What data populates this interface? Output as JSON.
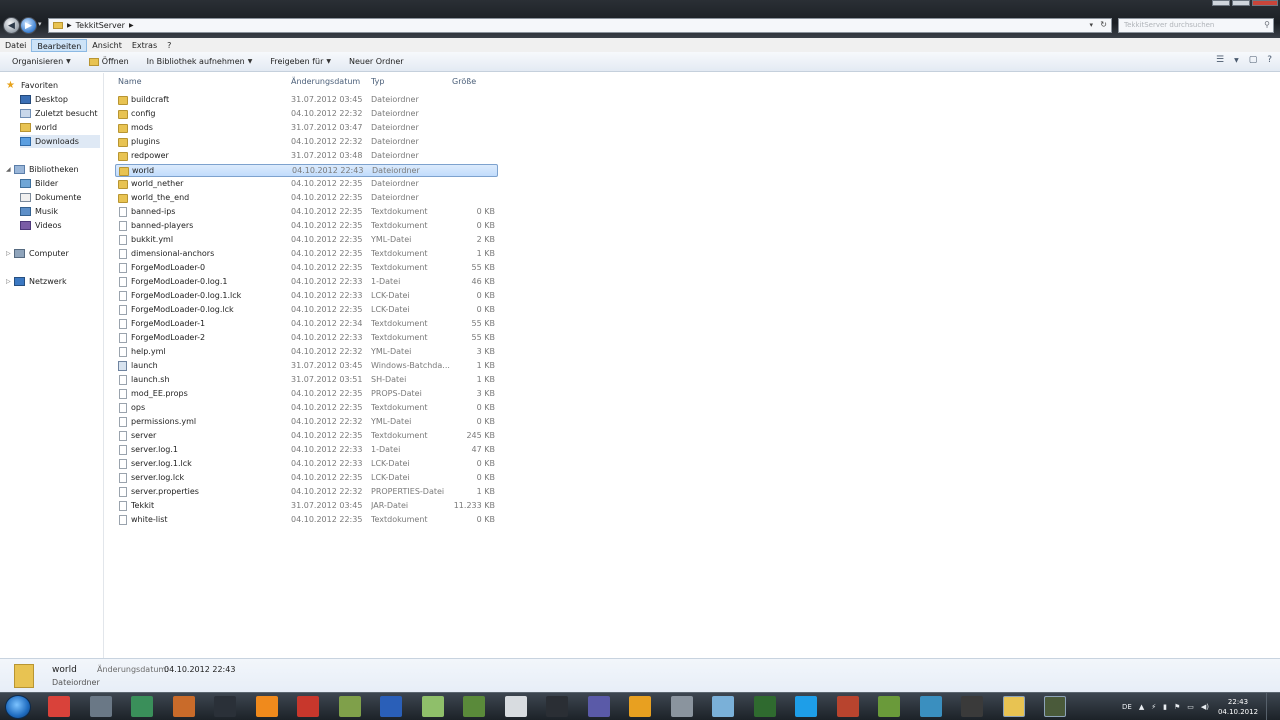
{
  "window": {
    "address_path": "TekkitServer",
    "search_placeholder": "TekkitServer durchsuchen"
  },
  "menu": [
    "Datei",
    "Bearbeiten",
    "Ansicht",
    "Extras",
    "?"
  ],
  "toolbar": {
    "organize": "Organisieren",
    "open": "Öffnen",
    "add_to_library": "In Bibliothek aufnehmen",
    "share": "Freigeben für",
    "new_folder": "Neuer Ordner"
  },
  "nav": {
    "favorites": "Favoriten",
    "desktop": "Desktop",
    "recent": "Zuletzt besucht",
    "world": "world",
    "downloads": "Downloads",
    "libraries": "Bibliotheken",
    "pictures": "Bilder",
    "documents": "Dokumente",
    "music": "Musik",
    "videos": "Videos",
    "computer": "Computer",
    "network": "Netzwerk"
  },
  "columns": {
    "name": "Name",
    "date": "Änderungsdatum",
    "type": "Typ",
    "size": "Größe"
  },
  "files": [
    {
      "name": "buildcraft",
      "date": "31.07.2012 03:45",
      "type": "Dateiordner",
      "size": "",
      "icon": "folder"
    },
    {
      "name": "config",
      "date": "04.10.2012 22:32",
      "type": "Dateiordner",
      "size": "",
      "icon": "folder"
    },
    {
      "name": "mods",
      "date": "31.07.2012 03:47",
      "type": "Dateiordner",
      "size": "",
      "icon": "folder"
    },
    {
      "name": "plugins",
      "date": "04.10.2012 22:32",
      "type": "Dateiordner",
      "size": "",
      "icon": "folder"
    },
    {
      "name": "redpower",
      "date": "31.07.2012 03:48",
      "type": "Dateiordner",
      "size": "",
      "icon": "folder"
    },
    {
      "name": "world",
      "date": "04.10.2012 22:43",
      "type": "Dateiordner",
      "size": "",
      "icon": "folder",
      "selected": true
    },
    {
      "name": "world_nether",
      "date": "04.10.2012 22:35",
      "type": "Dateiordner",
      "size": "",
      "icon": "folder"
    },
    {
      "name": "world_the_end",
      "date": "04.10.2012 22:35",
      "type": "Dateiordner",
      "size": "",
      "icon": "folder"
    },
    {
      "name": "banned-ips",
      "date": "04.10.2012 22:35",
      "type": "Textdokument",
      "size": "0 KB",
      "icon": "doc"
    },
    {
      "name": "banned-players",
      "date": "04.10.2012 22:35",
      "type": "Textdokument",
      "size": "0 KB",
      "icon": "doc"
    },
    {
      "name": "bukkit.yml",
      "date": "04.10.2012 22:35",
      "type": "YML-Datei",
      "size": "2 KB",
      "icon": "doc"
    },
    {
      "name": "dimensional-anchors",
      "date": "04.10.2012 22:35",
      "type": "Textdokument",
      "size": "1 KB",
      "icon": "doc"
    },
    {
      "name": "ForgeModLoader-0",
      "date": "04.10.2012 22:35",
      "type": "Textdokument",
      "size": "55 KB",
      "icon": "doc"
    },
    {
      "name": "ForgeModLoader-0.log.1",
      "date": "04.10.2012 22:33",
      "type": "1-Datei",
      "size": "46 KB",
      "icon": "doc"
    },
    {
      "name": "ForgeModLoader-0.log.1.lck",
      "date": "04.10.2012 22:33",
      "type": "LCK-Datei",
      "size": "0 KB",
      "icon": "doc"
    },
    {
      "name": "ForgeModLoader-0.log.lck",
      "date": "04.10.2012 22:35",
      "type": "LCK-Datei",
      "size": "0 KB",
      "icon": "doc"
    },
    {
      "name": "ForgeModLoader-1",
      "date": "04.10.2012 22:34",
      "type": "Textdokument",
      "size": "55 KB",
      "icon": "doc"
    },
    {
      "name": "ForgeModLoader-2",
      "date": "04.10.2012 22:33",
      "type": "Textdokument",
      "size": "55 KB",
      "icon": "doc"
    },
    {
      "name": "help.yml",
      "date": "04.10.2012 22:32",
      "type": "YML-Datei",
      "size": "3 KB",
      "icon": "doc"
    },
    {
      "name": "launch",
      "date": "31.07.2012 03:45",
      "type": "Windows-Batchda...",
      "size": "1 KB",
      "icon": "batch"
    },
    {
      "name": "launch.sh",
      "date": "31.07.2012 03:51",
      "type": "SH-Datei",
      "size": "1 KB",
      "icon": "doc"
    },
    {
      "name": "mod_EE.props",
      "date": "04.10.2012 22:35",
      "type": "PROPS-Datei",
      "size": "3 KB",
      "icon": "doc"
    },
    {
      "name": "ops",
      "date": "04.10.2012 22:35",
      "type": "Textdokument",
      "size": "0 KB",
      "icon": "doc"
    },
    {
      "name": "permissions.yml",
      "date": "04.10.2012 22:32",
      "type": "YML-Datei",
      "size": "0 KB",
      "icon": "doc"
    },
    {
      "name": "server",
      "date": "04.10.2012 22:35",
      "type": "Textdokument",
      "size": "245 KB",
      "icon": "doc"
    },
    {
      "name": "server.log.1",
      "date": "04.10.2012 22:33",
      "type": "1-Datei",
      "size": "47 KB",
      "icon": "doc"
    },
    {
      "name": "server.log.1.lck",
      "date": "04.10.2012 22:33",
      "type": "LCK-Datei",
      "size": "0 KB",
      "icon": "doc"
    },
    {
      "name": "server.log.lck",
      "date": "04.10.2012 22:35",
      "type": "LCK-Datei",
      "size": "0 KB",
      "icon": "doc"
    },
    {
      "name": "server.properties",
      "date": "04.10.2012 22:32",
      "type": "PROPERTIES-Datei",
      "size": "1 KB",
      "icon": "doc"
    },
    {
      "name": "Tekkit",
      "date": "31.07.2012 03:45",
      "type": "JAR-Datei",
      "size": "11.233 KB",
      "icon": "doc"
    },
    {
      "name": "white-list",
      "date": "04.10.2012 22:35",
      "type": "Textdokument",
      "size": "0 KB",
      "icon": "doc"
    }
  ],
  "details": {
    "name": "world",
    "type": "Dateiordner",
    "date_label": "Änderungsdatum:",
    "date": "04.10.2012 22:43"
  },
  "taskbar": {
    "apps": [
      {
        "name": "chrome-icon",
        "color": "#d9423a"
      },
      {
        "name": "steam-icon",
        "color": "#6a7886"
      },
      {
        "name": "app-window-icon",
        "color": "#3a8f5a"
      },
      {
        "name": "app-tools-icon",
        "color": "#c96b2a"
      },
      {
        "name": "obs-icon",
        "color": "#2a3038"
      },
      {
        "name": "vlc-icon",
        "color": "#f08a1c"
      },
      {
        "name": "app-red-icon",
        "color": "#c8372c"
      },
      {
        "name": "app-green-icon",
        "color": "#7fa04a"
      },
      {
        "name": "firefox-icon",
        "color": "#2a5fb8"
      },
      {
        "name": "app-pinned-icon",
        "color": "#8fbf6a"
      },
      {
        "name": "minecraft-icon",
        "color": "#5a8a3a"
      },
      {
        "name": "gamepad-icon",
        "color": "#d8dce0"
      },
      {
        "name": "app-dark-icon",
        "color": "#2a2e34"
      },
      {
        "name": "after-effects-icon",
        "color": "#5a5aa8"
      },
      {
        "name": "illustrator-icon",
        "color": "#e8a020"
      },
      {
        "name": "pen-icon",
        "color": "#8a949e"
      },
      {
        "name": "paint-icon",
        "color": "#7ab0d8"
      },
      {
        "name": "terminal-icon",
        "color": "#2f6a2f"
      },
      {
        "name": "skype-icon",
        "color": "#1e9ee8"
      },
      {
        "name": "app-eye-icon",
        "color": "#b8442e"
      },
      {
        "name": "minecraft-block-icon",
        "color": "#6a9a3a"
      },
      {
        "name": "app-notes-icon",
        "color": "#3a8fbf"
      },
      {
        "name": "tekkit-icon",
        "color": "#3a3a3a"
      },
      {
        "name": "explorer-icon",
        "color": "#e8c352"
      },
      {
        "name": "app-active-icon",
        "color": "#4a5a3a"
      }
    ],
    "language": "DE",
    "time": "22:43",
    "date": "04.10.2012"
  }
}
